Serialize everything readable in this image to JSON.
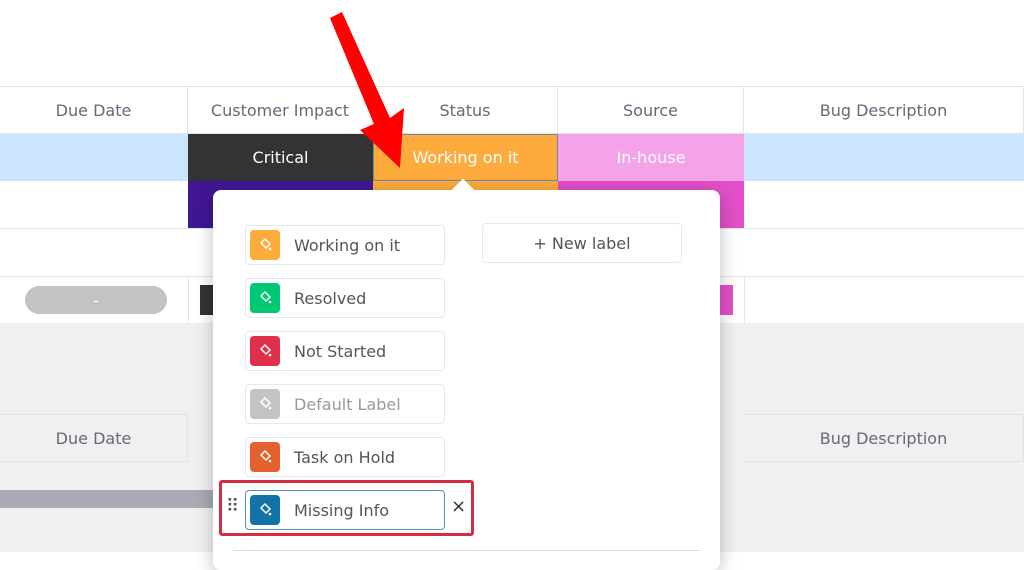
{
  "columns": [
    "Due Date",
    "Customer Impact",
    "Status",
    "Source",
    "Bug Description"
  ],
  "row1": {
    "impact": "Critical",
    "status": "Working on it",
    "source": "In-house"
  },
  "row3": {
    "due": "-"
  },
  "group2_columns": {
    "due": "Due Date",
    "bug": "Bug Description"
  },
  "popup": {
    "new_label": "+ New label",
    "labels": [
      {
        "label": "Working on it",
        "color": "#fdab3d"
      },
      {
        "label": "Resolved",
        "color": "#00c875"
      },
      {
        "label": "Not Started",
        "color": "#df2f4a"
      },
      {
        "label": "Default Label",
        "color": "#c4c4c4"
      },
      {
        "label": "Task on Hold",
        "color": "#e2612e"
      },
      {
        "label": "Missing Info",
        "color": "#1273a6"
      }
    ],
    "remove_icon": "×"
  },
  "colors": {
    "highlight": "#cce5ff",
    "critical": "#333333",
    "status": "#fdab3d",
    "inhouse": "#f5a3e8",
    "purple": "#401694",
    "magenta": "#e24fc8",
    "annotation": "#ff0000"
  }
}
